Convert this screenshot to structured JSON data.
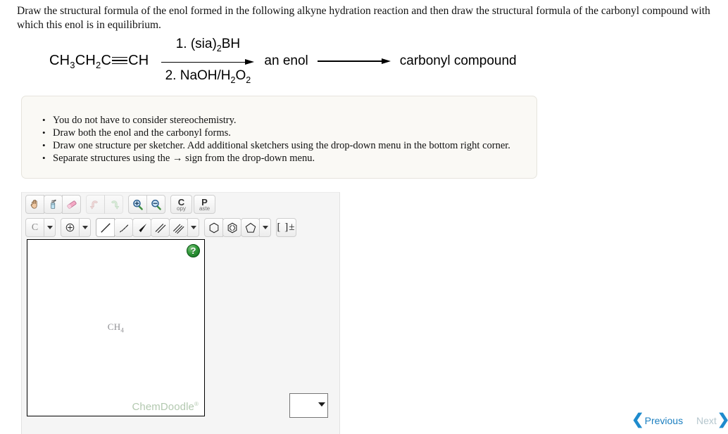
{
  "question": {
    "text": "Draw the structural formula of the enol formed in the following alkyne hydration reaction and then draw the structural formula of the carbonyl compound with which this enol is in equilibrium."
  },
  "reaction": {
    "reactant": "CH3CH2C≡CH",
    "reactant_parts": {
      "c1": "CH",
      "sub1": "3",
      "c2": "CH",
      "sub2": "2",
      "c3": "C",
      "c4": "CH"
    },
    "condition_top": "1. (sia)2BH",
    "condition_top_parts": {
      "pre": "1. (sia)",
      "sub": "2",
      "post": "BH"
    },
    "condition_bottom": "2. NaOH/H2O2",
    "condition_bottom_parts": {
      "pre": "2. NaOH/H",
      "sub1": "2",
      "mid": "O",
      "sub2": "2"
    },
    "intermediate_label": "an enol",
    "product_label": "carbonyl compound"
  },
  "instructions": {
    "items": [
      "You do not have to consider stereochemistry.",
      "Draw both the enol and the carbonyl forms.",
      "Draw one structure per sketcher. Add additional sketchers using the drop-down menu in the bottom right corner.",
      "Separate structures using the → sign from the drop-down menu."
    ]
  },
  "sketcher": {
    "toolbar_row1": [
      {
        "name": "pan-hand-tool",
        "title": "Move/Pan",
        "icon": "hand-icon",
        "state": "enabled"
      },
      {
        "name": "clear-tool",
        "title": "Clear",
        "icon": "spray-bottle-icon",
        "state": "enabled"
      },
      {
        "name": "eraser-tool",
        "title": "Erase",
        "icon": "eraser-icon",
        "state": "enabled"
      },
      {
        "name": "undo-tool",
        "title": "Undo",
        "icon": "undo-arrow-icon",
        "state": "disabled"
      },
      {
        "name": "redo-tool",
        "title": "Redo",
        "icon": "redo-arrow-icon",
        "state": "disabled"
      },
      {
        "name": "zoom-in-tool",
        "title": "Zoom In",
        "icon": "magnifier-plus-icon",
        "state": "enabled"
      },
      {
        "name": "zoom-out-tool",
        "title": "Zoom Out",
        "icon": "magnifier-minus-icon",
        "state": "enabled"
      },
      {
        "name": "copy-tool",
        "title": "Copy",
        "icon": "copy-icon",
        "state": "enabled"
      },
      {
        "name": "paste-tool",
        "title": "Paste",
        "icon": "paste-icon",
        "state": "enabled"
      }
    ],
    "copy_button": {
      "big": "C",
      "small": "opy"
    },
    "paste_button": {
      "big": "P",
      "small": "aste"
    },
    "element_button_label": "C",
    "toolbar_row2": [
      {
        "name": "element-carbon-tool",
        "title": "Carbon",
        "icon": "element-label-icon"
      },
      {
        "name": "element-dropdown",
        "title": "More elements",
        "icon": "chevron-down-icon"
      },
      {
        "name": "charge-tool",
        "title": "Charge",
        "icon": "circle-plus-icon"
      },
      {
        "name": "charge-dropdown",
        "title": "More charges",
        "icon": "chevron-down-icon"
      },
      {
        "name": "single-bond-tool",
        "title": "Single bond",
        "icon": "single-bond-icon"
      },
      {
        "name": "hash-bond-tool",
        "title": "Hashed wedge bond",
        "icon": "hashed-bond-icon"
      },
      {
        "name": "wedge-bond-tool",
        "title": "Wedge bond",
        "icon": "wedge-bond-icon"
      },
      {
        "name": "double-bond-tool",
        "title": "Double bond",
        "icon": "double-bond-icon"
      },
      {
        "name": "triple-bond-tool",
        "title": "Triple bond",
        "icon": "triple-bond-icon"
      },
      {
        "name": "bond-dropdown",
        "title": "More bonds",
        "icon": "chevron-down-icon"
      },
      {
        "name": "benzene-ring-tool",
        "title": "Benzene ring",
        "icon": "hexagon-icon"
      },
      {
        "name": "aromatic-ring-tool",
        "title": "Aromatic ring",
        "icon": "aromatic-hexagon-icon"
      },
      {
        "name": "cyclopentane-ring-tool",
        "title": "Cyclopentane ring",
        "icon": "pentagon-icon"
      },
      {
        "name": "ring-dropdown",
        "title": "More rings",
        "icon": "chevron-down-icon"
      },
      {
        "name": "bracket-charge-tool",
        "title": "Brackets and charge",
        "icon": "bracket-plus-minus-icon"
      }
    ],
    "bracket_label": "[ ]±",
    "canvas": {
      "formula": "CH4",
      "formula_parts": {
        "text": "CH",
        "sub": "4"
      },
      "help_label": "?",
      "watermark": "ChemDoodle",
      "watermark_mark": "®"
    },
    "select": {
      "value": "",
      "options": []
    }
  },
  "navigation": {
    "previous_label": "Previous",
    "next_label": "Next",
    "previous_chevron": "❮",
    "next_chevron": "❯"
  },
  "colors": {
    "accent_blue": "#1b7fc0",
    "chevron_blue": "#1e8bcd",
    "next_disabled": "#b6c7ce",
    "card_bg": "#faf9f5",
    "panel_bg": "#f5f5f5",
    "watermark_green": "#b3c9b0",
    "help_green": "#31993a"
  }
}
